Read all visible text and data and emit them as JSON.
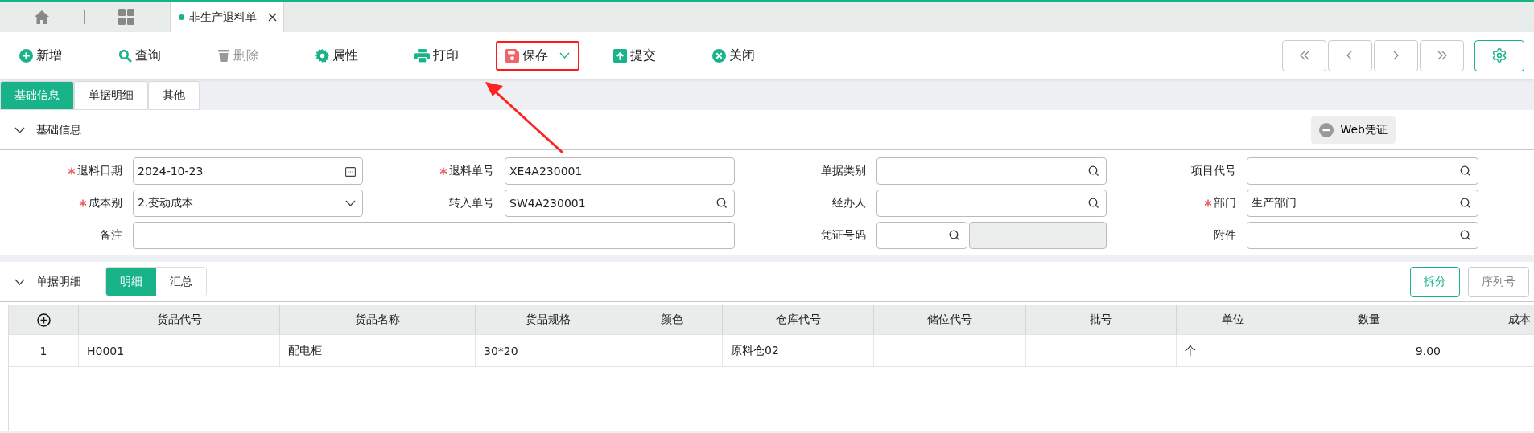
{
  "tabs": [
    {
      "label": "非生产退料单",
      "selected": true,
      "closable": true
    }
  ],
  "toolbar": [
    {
      "kind": "add",
      "label": "新增",
      "disabled": false,
      "highlighted": false,
      "dropdown": false
    },
    {
      "kind": "search",
      "label": "查询",
      "disabled": false,
      "highlighted": false,
      "dropdown": false
    },
    {
      "kind": "delete",
      "label": "删除",
      "disabled": true,
      "highlighted": false,
      "dropdown": false
    },
    {
      "kind": "gear",
      "label": "属性",
      "disabled": false,
      "highlighted": false,
      "dropdown": false
    },
    {
      "kind": "print",
      "label": "打印",
      "disabled": false,
      "highlighted": false,
      "dropdown": false
    },
    {
      "kind": "save",
      "label": "保存",
      "disabled": false,
      "highlighted": true,
      "dropdown": true
    },
    {
      "kind": "submit",
      "label": "提交",
      "disabled": false,
      "highlighted": false,
      "dropdown": false
    },
    {
      "kind": "close",
      "label": "关闭",
      "disabled": false,
      "highlighted": false,
      "dropdown": false
    }
  ],
  "sub_tabs": [
    {
      "label": "基础信息",
      "selected": true
    },
    {
      "label": "单据明细",
      "selected": false
    },
    {
      "label": "其他",
      "selected": false
    }
  ],
  "basic_section": {
    "title": "基础信息",
    "expanded": true,
    "web_voucher_button": "Web凭证"
  },
  "fields": [
    {
      "kind": "date",
      "label": "退料日期",
      "required": true,
      "value": "2024-10-23"
    },
    {
      "kind": "text",
      "label": "退料单号",
      "required": true,
      "value": "XE4A230001"
    },
    {
      "kind": "lookup",
      "label": "单据类别",
      "required": false
    },
    {
      "kind": "lookup",
      "label": "项目代号",
      "required": false
    },
    {
      "kind": "select",
      "label": "成本别",
      "required": true,
      "value": "2.变动成本"
    },
    {
      "kind": "lookup",
      "label": "转入单号",
      "required": false,
      "value": "SW4A230001"
    },
    {
      "kind": "lookup",
      "label": "经办人",
      "required": false
    },
    {
      "kind": "lookup",
      "label": "部门",
      "required": true,
      "value": "生产部门"
    },
    {
      "kind": "wide",
      "label": "备注",
      "required": false
    },
    {
      "kind": "voucher",
      "label": "凭证号码",
      "required": false
    },
    {
      "kind": "lookup",
      "label": "附件",
      "required": false
    }
  ],
  "detail_section": {
    "title": "单据明细",
    "expanded": true,
    "view_tabs": [
      {
        "label": "明细",
        "selected": true
      },
      {
        "label": "汇总",
        "selected": false
      }
    ],
    "actions": [
      {
        "label": "拆分",
        "disabled": false
      },
      {
        "label": "序列号",
        "disabled": true
      }
    ]
  },
  "table": {
    "columns": [
      {
        "kind": "index"
      },
      {
        "kind": "text",
        "label": "货品代号"
      },
      {
        "kind": "text",
        "label": "货品名称"
      },
      {
        "kind": "text",
        "label": "货品规格"
      },
      {
        "kind": "text",
        "label": "颜色"
      },
      {
        "kind": "text",
        "label": "仓库代号"
      },
      {
        "kind": "text",
        "label": "储位代号"
      },
      {
        "kind": "text",
        "label": "批号"
      },
      {
        "kind": "text",
        "label": "单位"
      },
      {
        "kind": "number",
        "label": "数量"
      },
      {
        "kind": "text",
        "label": "成本"
      }
    ],
    "rows": [
      [
        "1",
        "H0001",
        "配电柜",
        "30*20",
        null,
        "原料仓02",
        null,
        null,
        "个",
        "9.00",
        null
      ]
    ]
  }
}
